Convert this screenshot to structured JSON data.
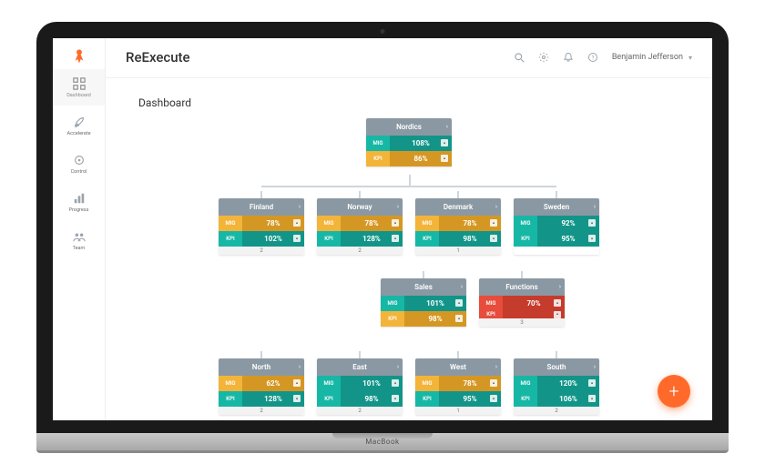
{
  "colors": {
    "accent": "#ff6a2b",
    "teal": "#17b7a6",
    "amber": "#f3b43a",
    "red": "#e74c3c",
    "grayHead": "#8a98a3"
  },
  "laptop": {
    "brand": "MacBook"
  },
  "sidebar": {
    "items": [
      {
        "label": "Dashboard"
      },
      {
        "label": "Accelerate"
      },
      {
        "label": "Control"
      },
      {
        "label": "Progress"
      },
      {
        "label": "Team"
      }
    ]
  },
  "header": {
    "appTitle": "ReExecute",
    "user": "Benjamin Jefferson"
  },
  "section": {
    "title": "Dashboard"
  },
  "metricLabels": {
    "mig": "MIG",
    "kpi": "KPI"
  },
  "tree": {
    "root": {
      "name": "Nordics",
      "mig": "108%",
      "migStatus": "teal",
      "kpi": "86%",
      "kpiStatus": "amber",
      "footer": ""
    },
    "level1": [
      {
        "name": "Finland",
        "mig": "78%",
        "migStatus": "amber",
        "kpi": "102%",
        "kpiStatus": "teal",
        "footer": "2"
      },
      {
        "name": "Norway",
        "mig": "78%",
        "migStatus": "amber",
        "kpi": "128%",
        "kpiStatus": "teal",
        "footer": "2"
      },
      {
        "name": "Denmark",
        "mig": "78%",
        "migStatus": "amber",
        "kpi": "98%",
        "kpiStatus": "teal",
        "footer": "1"
      },
      {
        "name": "Sweden",
        "mig": "92%",
        "migStatus": "teal",
        "kpi": "95%",
        "kpiStatus": "teal",
        "footer": ""
      }
    ],
    "level2": [
      {
        "name": "Sales",
        "mig": "101%",
        "migStatus": "teal",
        "kpi": "98%",
        "kpiStatus": "amber",
        "footer": ""
      },
      {
        "name": "Functions",
        "mig": "70%",
        "migStatus": "red",
        "kpi": "",
        "kpiStatus": "red",
        "footer": "3"
      }
    ],
    "level3": [
      {
        "name": "North",
        "mig": "62%",
        "migStatus": "amber",
        "kpi": "128%",
        "kpiStatus": "teal",
        "footer": "2"
      },
      {
        "name": "East",
        "mig": "101%",
        "migStatus": "teal",
        "kpi": "98%",
        "kpiStatus": "teal",
        "footer": "2"
      },
      {
        "name": "West",
        "mig": "78%",
        "migStatus": "amber",
        "kpi": "95%",
        "kpiStatus": "teal",
        "footer": "1"
      },
      {
        "name": "South",
        "mig": "120%",
        "migStatus": "teal",
        "kpi": "106%",
        "kpiStatus": "teal",
        "footer": "2"
      }
    ]
  },
  "fab": {
    "label": "+"
  }
}
